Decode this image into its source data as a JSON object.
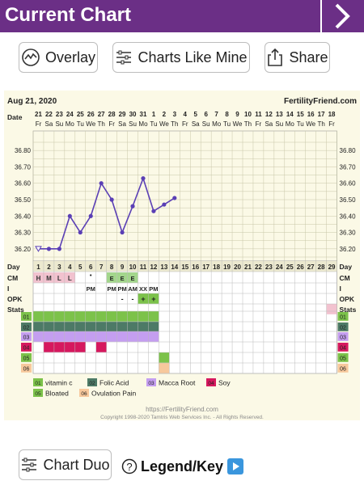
{
  "header": {
    "title": "Current Chart"
  },
  "toolbar": {
    "overlay_label": "Overlay",
    "charts_like_mine_label": "Charts Like Mine",
    "share_label": "Share"
  },
  "chart": {
    "date": "Aug 21, 2020",
    "brand": "FertilityFriend.com",
    "date_row_label": "Date",
    "dates": [
      "21",
      "22",
      "23",
      "24",
      "25",
      "26",
      "27",
      "28",
      "29",
      "30",
      "31",
      "1",
      "2",
      "3",
      "4",
      "5",
      "6",
      "7",
      "8",
      "9",
      "10",
      "11",
      "12",
      "13",
      "14",
      "15",
      "16",
      "17",
      "18"
    ],
    "weekdays": [
      "Fr",
      "Sa",
      "Su",
      "Mo",
      "Tu",
      "We",
      "Th",
      "Fr",
      "Sa",
      "Su",
      "Mo",
      "Tu",
      "We",
      "Th",
      "Fr",
      "Sa",
      "Su",
      "Mo",
      "Tu",
      "We",
      "Th",
      "Fr",
      "Sa",
      "Su",
      "Mo",
      "Tu",
      "We",
      "Th",
      "Fr"
    ],
    "temp_ticks": [
      "36.80",
      "36.70",
      "36.60",
      "36.50",
      "36.40",
      "36.30",
      "36.20"
    ],
    "day_label": "Day",
    "days": [
      "1",
      "2",
      "3",
      "4",
      "5",
      "6",
      "7",
      "8",
      "9",
      "10",
      "11",
      "12",
      "13",
      "14",
      "15",
      "16",
      "17",
      "18",
      "19",
      "20",
      "21",
      "22",
      "23",
      "24",
      "25",
      "26",
      "27",
      "28",
      "29"
    ],
    "row_labels": [
      "CM",
      "I",
      "OPK",
      "Stats"
    ],
    "cm_values": [
      "H",
      "M",
      "L",
      "L"
    ],
    "i_values": [
      {
        "day": 6,
        "text": "•"
      },
      {
        "day": 6,
        "text": "PM"
      },
      {
        "day": 8,
        "text": "E"
      },
      {
        "day": 9,
        "text": "E"
      },
      {
        "day": 10,
        "text": "E"
      },
      {
        "day": 8,
        "text": "PM"
      },
      {
        "day": 9,
        "text": "PM"
      },
      {
        "day": 10,
        "text": "AM"
      },
      {
        "day": 11,
        "text": "XX"
      },
      {
        "day": 12,
        "text": "PM"
      }
    ],
    "opk_values": [
      {
        "day": 9,
        "text": "-"
      },
      {
        "day": 10,
        "text": "-"
      },
      {
        "day": 11,
        "text": "+"
      },
      {
        "day": 12,
        "text": "+"
      }
    ],
    "symptom_codes": [
      "01",
      "02",
      "03",
      "04",
      "05",
      "06"
    ],
    "legend": [
      {
        "code": "01",
        "label": "vitamin c",
        "color": "#7cc24a"
      },
      {
        "code": "02",
        "label": "Folic Acid",
        "color": "#4d7a66"
      },
      {
        "code": "03",
        "label": "Macca Root",
        "color": "#c49ef0"
      },
      {
        "code": "04",
        "label": "Soy",
        "color": "#d6185e"
      },
      {
        "code": "05",
        "label": "Bloated",
        "color": "#7cc24a"
      },
      {
        "code": "06",
        "label": "Ovulation Pain",
        "color": "#f7c89c"
      }
    ],
    "footer_url": "https://FertilityFriend.com",
    "copyright": "Copyright 1998-2020 Tamtris Web Services Inc. - All Rights Reserved."
  },
  "chart_data": {
    "type": "line",
    "x": [
      1,
      2,
      3,
      4,
      5,
      6,
      7,
      8,
      9,
      10,
      11,
      12,
      13,
      14
    ],
    "values": [
      36.2,
      36.2,
      36.2,
      36.4,
      36.3,
      36.4,
      36.6,
      36.5,
      36.3,
      36.46,
      36.63,
      36.43,
      36.47,
      36.51
    ],
    "ylim": [
      36.15,
      36.85
    ],
    "first_point_open": true,
    "color": "#5a3fb5"
  },
  "bottom": {
    "chart_duo_label": "Chart Duo",
    "legend_key_label": "Legend/Key"
  }
}
